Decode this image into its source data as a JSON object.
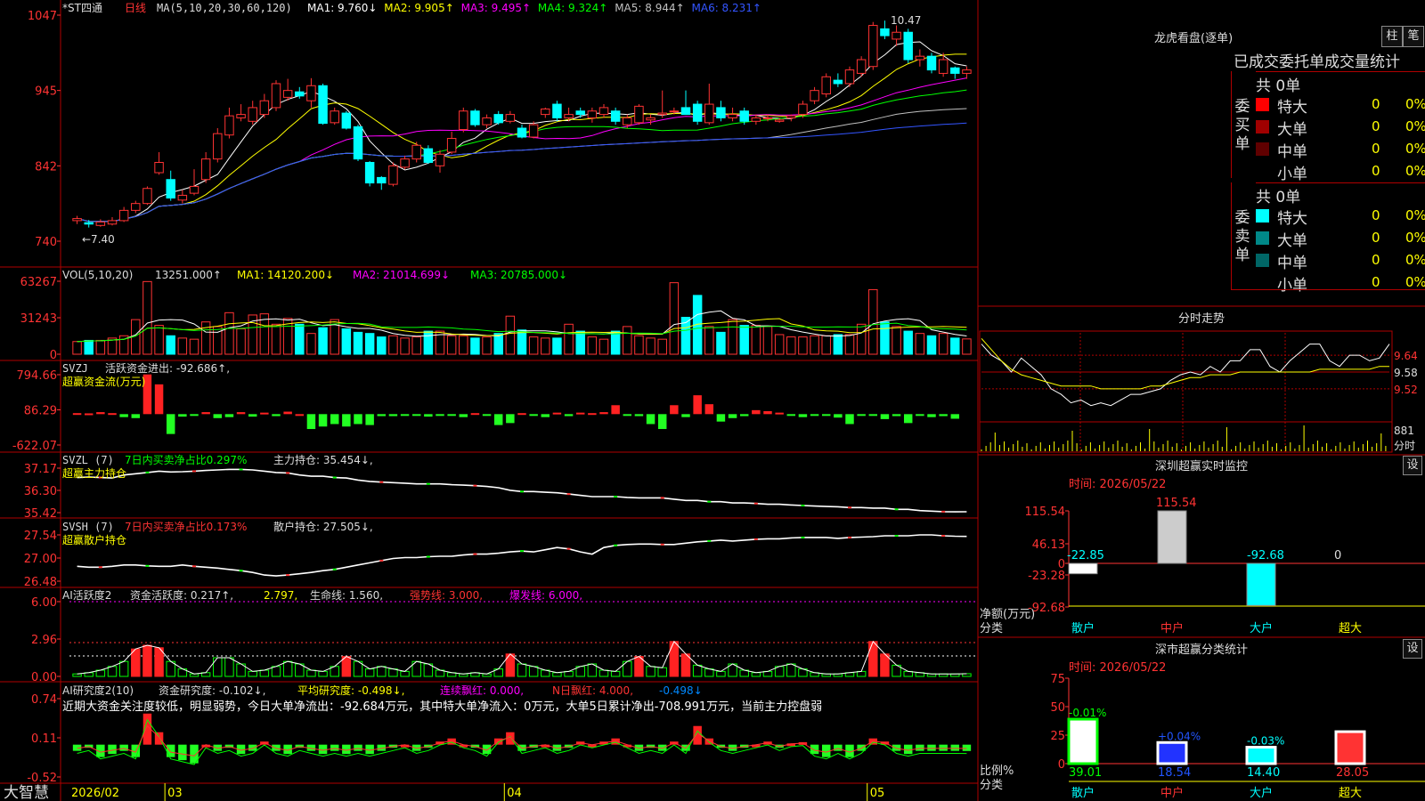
{
  "chart_data": {
    "type": "stock-candlestick",
    "stock": "*ST四通",
    "period": "日线",
    "date_label": "2026/02",
    "month_labels": [
      "03",
      "04",
      "05"
    ],
    "price_axis": [
      1047,
      945,
      842,
      740
    ],
    "ylim": [
      7.25,
      10.55
    ],
    "max_label": "10.47",
    "min_label": "←7.40",
    "ma_header": "MA(5,10,20,30,60,120)",
    "ma_values": [
      {
        "name": "MA1",
        "value": "9.760↓",
        "color": "#ffffff"
      },
      {
        "name": "MA2",
        "value": "9.905↑",
        "color": "#ffff00"
      },
      {
        "name": "MA3",
        "value": "9.495↑",
        "color": "#ff00ff"
      },
      {
        "name": "MA4",
        "value": "9.324↑",
        "color": "#00ff00"
      },
      {
        "name": "MA5",
        "value": "8.944↑",
        "color": "#c0c0c0"
      },
      {
        "name": "MA6",
        "value": "8.231↑",
        "color": "#3355ff"
      }
    ],
    "candles": [
      [
        7.55,
        7.58,
        7.5,
        7.62
      ],
      [
        7.52,
        7.5,
        7.45,
        7.56
      ],
      [
        7.48,
        7.53,
        7.46,
        7.57
      ],
      [
        7.5,
        7.55,
        7.48,
        7.6
      ],
      [
        7.55,
        7.7,
        7.53,
        7.75
      ],
      [
        7.7,
        7.8,
        7.66,
        7.84
      ],
      [
        7.8,
        8.02,
        7.78,
        8.05
      ],
      [
        8.25,
        8.4,
        8.22,
        8.55
      ],
      [
        8.15,
        7.88,
        7.84,
        8.28
      ],
      [
        7.85,
        7.92,
        7.8,
        8.0
      ],
      [
        7.95,
        8.05,
        7.92,
        8.3
      ],
      [
        8.15,
        8.45,
        8.1,
        8.55
      ],
      [
        8.45,
        8.82,
        8.4,
        8.9
      ],
      [
        8.8,
        9.08,
        8.75,
        9.2
      ],
      [
        9.05,
        9.1,
        9.0,
        9.25
      ],
      [
        9.0,
        9.2,
        8.95,
        9.3
      ],
      [
        9.1,
        9.3,
        9.05,
        9.4
      ],
      [
        9.2,
        9.55,
        9.15,
        9.6
      ],
      [
        9.35,
        9.45,
        9.3,
        9.62
      ],
      [
        9.43,
        9.37,
        9.33,
        9.5
      ],
      [
        9.3,
        9.52,
        9.2,
        9.63
      ],
      [
        9.52,
        8.97,
        8.95,
        9.55
      ],
      [
        8.98,
        9.15,
        8.95,
        9.2
      ],
      [
        9.12,
        8.9,
        8.88,
        9.15
      ],
      [
        8.92,
        8.45,
        8.42,
        8.95
      ],
      [
        8.4,
        8.1,
        8.05,
        8.42
      ],
      [
        8.18,
        8.1,
        8.0,
        8.2
      ],
      [
        8.08,
        8.35,
        8.05,
        8.4
      ],
      [
        8.33,
        8.45,
        8.3,
        8.5
      ],
      [
        8.45,
        8.65,
        8.4,
        8.7
      ],
      [
        8.6,
        8.4,
        8.38,
        8.65
      ],
      [
        8.35,
        8.52,
        8.25,
        8.58
      ],
      [
        8.55,
        8.75,
        8.52,
        8.85
      ],
      [
        8.88,
        9.15,
        8.84,
        9.2
      ],
      [
        9.15,
        8.95,
        8.92,
        9.18
      ],
      [
        8.95,
        9.05,
        8.9,
        9.1
      ],
      [
        9.1,
        8.98,
        8.95,
        9.15
      ],
      [
        9.0,
        9.1,
        8.97,
        9.15
      ],
      [
        8.9,
        8.77,
        8.75,
        8.95
      ],
      [
        8.77,
        8.95,
        8.75,
        9.0
      ],
      [
        9.1,
        9.18,
        9.05,
        9.2
      ],
      [
        9.25,
        9.05,
        9.0,
        9.3
      ],
      [
        9.05,
        9.1,
        9.0,
        9.2
      ],
      [
        9.15,
        9.1,
        9.05,
        9.2
      ],
      [
        9.05,
        9.15,
        8.98,
        9.2
      ],
      [
        9.1,
        9.2,
        9.05,
        9.25
      ],
      [
        9.15,
        9.0,
        8.95,
        9.2
      ],
      [
        8.95,
        9.05,
        8.9,
        9.1
      ],
      [
        8.98,
        9.22,
        8.95,
        9.25
      ],
      [
        9.02,
        9.05,
        8.95,
        9.1
      ],
      [
        9.1,
        9.12,
        9.05,
        9.45
      ],
      [
        9.15,
        9.15,
        9.1,
        9.2
      ],
      [
        9.2,
        9.1,
        9.1,
        9.45
      ],
      [
        9.25,
        9.0,
        8.95,
        9.3
      ],
      [
        8.98,
        9.25,
        8.95,
        9.55
      ],
      [
        9.2,
        9.05,
        9.0,
        9.3
      ],
      [
        9.05,
        9.1,
        9.0,
        9.2
      ],
      [
        9.15,
        9.0,
        8.95,
        9.2
      ],
      [
        9.0,
        9.05,
        8.95,
        9.1
      ],
      [
        9.05,
        9.05,
        9.0,
        9.1
      ],
      [
        9.0,
        9.02,
        8.98,
        9.05
      ],
      [
        9.05,
        9.08,
        9.0,
        9.1
      ],
      [
        9.1,
        9.25,
        9.05,
        9.3
      ],
      [
        9.3,
        9.45,
        9.25,
        9.5
      ],
      [
        9.4,
        9.65,
        9.35,
        9.7
      ],
      [
        9.6,
        9.55,
        9.5,
        9.7
      ],
      [
        9.55,
        9.75,
        9.5,
        9.8
      ],
      [
        9.7,
        9.9,
        9.65,
        9.95
      ],
      [
        9.8,
        10.4,
        9.75,
        10.45
      ],
      [
        10.35,
        10.25,
        10.2,
        10.47
      ],
      [
        10.2,
        10.3,
        10.1,
        10.4
      ],
      [
        10.3,
        9.9,
        9.85,
        10.35
      ],
      [
        9.9,
        9.95,
        9.8,
        10.05
      ],
      [
        9.95,
        9.75,
        9.7,
        10.0
      ],
      [
        9.7,
        9.9,
        9.65,
        10.0
      ],
      [
        9.78,
        9.7,
        9.62,
        9.8
      ],
      [
        9.7,
        9.75,
        9.62,
        9.8
      ]
    ],
    "vol_header": {
      "name": "VOL(5,10,20)",
      "value": "13251.000↑",
      "ma1": "MA1: 14120.200↓",
      "ma2": "MA2: 21014.699↓",
      "ma3": "MA3: 20785.000↓"
    },
    "vol_axis": [
      "63267",
      "31243",
      "0"
    ],
    "volumes": [
      11000,
      12000,
      12000,
      14000,
      16000,
      30000,
      63000,
      25000,
      16000,
      14000,
      13000,
      28000,
      24000,
      36000,
      22000,
      34000,
      35000,
      26000,
      31000,
      26000,
      18000,
      23000,
      30000,
      22000,
      19000,
      18000,
      15000,
      16000,
      14000,
      15000,
      20000,
      20000,
      16000,
      16000,
      14000,
      15000,
      18000,
      33000,
      21000,
      15000,
      14000,
      14000,
      26000,
      20000,
      15000,
      13000,
      20000,
      24000,
      16000,
      14000,
      13000,
      62000,
      32000,
      51000,
      24000,
      19000,
      30000,
      25000,
      25000,
      24000,
      17000,
      15000,
      15000,
      16000,
      16000,
      17000,
      17000,
      26000,
      56000,
      28000,
      24000,
      20000,
      18000,
      16000,
      18000,
      14000,
      13251
    ],
    "svzj_header": {
      "name": "SVZJ",
      "label": "活跃资金进出: -92.686↑,",
      "sub": "超赢资金流(万元)"
    },
    "svzj_axis": [
      "794.66",
      "86.29",
      "-622.07"
    ],
    "svzj": [
      20,
      15,
      40,
      20,
      -60,
      -80,
      800,
      600,
      -400,
      -50,
      -20,
      40,
      -80,
      -60,
      40,
      -50,
      30,
      -40,
      50,
      0,
      -300,
      -250,
      -200,
      -250,
      -200,
      -220,
      -40,
      -40,
      -30,
      -20,
      -50,
      -30,
      -20,
      -60,
      20,
      -30,
      -220,
      -180,
      20,
      -30,
      -60,
      30,
      -40,
      30,
      20,
      40,
      180,
      -30,
      -40,
      -200,
      -300,
      180,
      -60,
      380,
      200,
      -150,
      -80,
      -40,
      80,
      60,
      30,
      -30,
      -60,
      -30,
      -30,
      -70,
      -200,
      -30,
      -20,
      -100,
      -40,
      -180,
      -30,
      -60,
      -40,
      -92.686
    ],
    "svzl_header": {
      "name": "SVZL (7)",
      "net": "7日内买卖净占比0.297%",
      "pos": "主力持仓: 35.454↓,",
      "sub": "超赢主力持仓"
    },
    "svzl_axis": [
      "37.17",
      "36.30",
      "35.42"
    ],
    "svzl": [
      36.8,
      36.82,
      36.8,
      36.78,
      36.9,
      36.95,
      37.0,
      37.05,
      37.02,
      37.03,
      37.05,
      37.08,
      37.1,
      37.12,
      37.12,
      37.1,
      37.05,
      37.0,
      36.98,
      36.9,
      36.85,
      36.85,
      36.8,
      36.78,
      36.7,
      36.65,
      36.62,
      36.6,
      36.58,
      36.55,
      36.55,
      36.55,
      36.52,
      36.5,
      36.48,
      36.45,
      36.4,
      36.3,
      36.25,
      36.25,
      36.22,
      36.2,
      36.15,
      36.1,
      36.05,
      36.05,
      36.05,
      36.02,
      36.0,
      36.0,
      36.0,
      35.95,
      35.9,
      35.9,
      35.85,
      35.85,
      35.8,
      35.8,
      35.78,
      35.75,
      35.75,
      35.72,
      35.7,
      35.68,
      35.66,
      35.65,
      35.62,
      35.62,
      35.6,
      35.6,
      35.55,
      35.55,
      35.5,
      35.48,
      35.46,
      35.45,
      35.454
    ],
    "svsh_header": {
      "name": "SVSH (7)",
      "net": "7日内买卖净占比0.173%",
      "pos": "散户持仓: 27.505↓,",
      "sub": "超赢散户持仓"
    },
    "svsh_axis": [
      "27.54",
      "27.00",
      "26.48"
    ],
    "svsh": [
      26.82,
      26.8,
      26.8,
      26.82,
      26.85,
      26.85,
      26.83,
      26.82,
      26.82,
      26.85,
      26.82,
      26.8,
      26.78,
      26.75,
      26.72,
      26.68,
      26.62,
      26.6,
      26.62,
      26.65,
      26.68,
      26.72,
      26.75,
      26.8,
      26.85,
      26.9,
      26.95,
      27.0,
      27.02,
      27.02,
      27.04,
      27.05,
      27.05,
      27.08,
      27.1,
      27.1,
      27.12,
      27.15,
      27.17,
      27.15,
      27.2,
      27.25,
      27.22,
      27.15,
      27.1,
      27.25,
      27.3,
      27.32,
      27.33,
      27.33,
      27.32,
      27.32,
      27.35,
      27.38,
      27.4,
      27.42,
      27.4,
      27.42,
      27.44,
      27.45,
      27.45,
      27.47,
      27.48,
      27.48,
      27.48,
      27.46,
      27.48,
      27.49,
      27.5,
      27.52,
      27.52,
      27.52,
      27.54,
      27.54,
      27.52,
      27.51,
      27.505
    ],
    "ai_header": {
      "name": "AI活跃度2",
      "a": "资金活跃度: 0.217↑,",
      "b": "2.797,",
      "c": "生命线: 1.560,",
      "d": "强势线: 3.000,",
      "e": "爆发线: 6.000,"
    },
    "ai_axis": [
      "6.00",
      "2.96",
      "0.00"
    ],
    "ai": [
      0.2,
      0.3,
      0.5,
      0.8,
      1.2,
      2.2,
      2.5,
      2.3,
      1.2,
      0.6,
      0.2,
      0.3,
      1.5,
      1.5,
      1.0,
      0.4,
      0.5,
      0.8,
      1.2,
      1.0,
      0.5,
      0.4,
      0.8,
      1.6,
      1.2,
      0.6,
      0.8,
      0.6,
      0.4,
      1.2,
      1.0,
      0.5,
      0.3,
      0.2,
      0.3,
      0.2,
      0.6,
      1.8,
      1.0,
      0.8,
      0.5,
      0.3,
      0.4,
      0.8,
      1.0,
      0.5,
      0.4,
      1.2,
      1.6,
      0.8,
      0.7,
      2.8,
      1.8,
      0.9,
      0.6,
      0.4,
      1.0,
      0.5,
      0.3,
      0.4,
      0.8,
      1.0,
      0.6,
      0.3,
      0.2,
      0.2,
      0.3,
      0.4,
      2.8,
      1.8,
      0.9,
      0.4,
      0.3,
      0.2,
      0.2,
      0.2,
      0.217
    ],
    "ai2_header": {
      "name": "AI研究度2(10)",
      "a": "资金研究度: -0.102↓,",
      "b": "平均研究度: -0.498↓,",
      "c": "连续飘红: 0.000,",
      "d": "N日飘红: 4.000,",
      "e": "-0.498↓"
    },
    "ai2_axis": [
      "0.74",
      "0.11",
      "-0.52"
    ],
    "ai2_text": "近期大资金关注度较低，明显弱势，今日大单净流出：-92.684万元，其中特大单净流入：0万元，大单5日累计净出-708.991万元，当前主力控盘弱",
    "ai2": [
      -0.1,
      -0.05,
      -0.2,
      -0.15,
      -0.1,
      -0.2,
      0.5,
      0.2,
      -0.2,
      -0.25,
      -0.3,
      0.0,
      -0.1,
      -0.05,
      -0.15,
      -0.1,
      0.05,
      -0.1,
      -0.15,
      -0.05,
      -0.1,
      -0.15,
      -0.1,
      -0.15,
      -0.1,
      -0.15,
      -0.1,
      -0.05,
      0.0,
      -0.1,
      -0.05,
      0.05,
      0.1,
      0.0,
      -0.05,
      -0.15,
      0.1,
      0.2,
      -0.1,
      -0.05,
      0.0,
      -0.1,
      -0.05,
      0.05,
      0.0,
      0.05,
      0.1,
      0.0,
      -0.1,
      -0.05,
      -0.1,
      0.05,
      -0.1,
      0.3,
      0.1,
      -0.05,
      -0.1,
      -0.05,
      0.0,
      0.05,
      -0.05,
      0.02,
      0.04,
      -0.15,
      -0.2,
      -0.1,
      -0.2,
      -0.1,
      0.1,
      0.05,
      -0.1,
      -0.15,
      -0.1,
      -0.1,
      -0.1,
      -0.1,
      -0.102
    ]
  },
  "brand": "大智慧",
  "longhu": {
    "title": "龙虎看盘(逐单)",
    "tab1": "柱",
    "tab2": "笔",
    "subtitle": "已成交委托单成交量统计",
    "buy": {
      "group": "委买单",
      "total": "共 0单",
      "rows": [
        {
          "label": "特大",
          "v": "0",
          "p": "0%",
          "color": "#ff0000"
        },
        {
          "label": "大单",
          "v": "0",
          "p": "0%",
          "color": "#a00000"
        },
        {
          "label": "中单",
          "v": "0",
          "p": "0%",
          "color": "#600000"
        },
        {
          "label": "小单",
          "v": "0",
          "p": "0%",
          "color": "#000000"
        }
      ]
    },
    "sell": {
      "group": "委卖单",
      "total": "共 0单",
      "rows": [
        {
          "label": "特大",
          "v": "0",
          "p": "0%",
          "color": "#00ffff"
        },
        {
          "label": "大单",
          "v": "0",
          "p": "0%",
          "color": "#008888"
        },
        {
          "label": "中单",
          "v": "0",
          "p": "0%",
          "color": "#006666"
        },
        {
          "label": "小单",
          "v": "0",
          "p": "0%",
          "color": "#000000"
        }
      ]
    }
  },
  "fenshi": {
    "title": "分时走势",
    "axis": [
      "9.64",
      "9.58",
      "9.52"
    ],
    "vol_label": "881",
    "vol_unit": "分时",
    "price": [
      9.68,
      9.64,
      9.62,
      9.58,
      9.63,
      9.6,
      9.57,
      9.52,
      9.5,
      9.47,
      9.48,
      9.46,
      9.47,
      9.46,
      9.48,
      9.5,
      9.5,
      9.51,
      9.52,
      9.55,
      9.57,
      9.58,
      9.57,
      9.6,
      9.58,
      9.62,
      9.62,
      9.66,
      9.66,
      9.6,
      9.58,
      9.62,
      9.65,
      9.68,
      9.68,
      9.62,
      9.6,
      9.64,
      9.64,
      9.62,
      9.63,
      9.68
    ],
    "avg": [
      9.7,
      9.66,
      9.62,
      9.59,
      9.57,
      9.56,
      9.55,
      9.54,
      9.53,
      9.53,
      9.53,
      9.53,
      9.52,
      9.52,
      9.52,
      9.52,
      9.52,
      9.53,
      9.53,
      9.54,
      9.55,
      9.56,
      9.56,
      9.57,
      9.57,
      9.57,
      9.58,
      9.58,
      9.58,
      9.58,
      9.58,
      9.58,
      9.58,
      9.58,
      9.59,
      9.59,
      9.59,
      9.59,
      9.59,
      9.59,
      9.6,
      9.6
    ]
  },
  "sz_monitor": {
    "title": "深圳超赢实时监控",
    "button": "设",
    "time": "时间: 2026/05/22",
    "axis": [
      "115.54",
      "46.13",
      "0",
      "-23.28",
      "-92.68"
    ],
    "unit_label": "净额(万元)",
    "cat_label": "分类",
    "bars": [
      {
        "name": "散户",
        "value": -22.85,
        "label": "-22.85"
      },
      {
        "name": "中户",
        "value": 115.54,
        "label": "115.54"
      },
      {
        "name": "大户",
        "value": -92.68,
        "label": "-92.68"
      },
      {
        "name": "超大",
        "value": 0,
        "label": "0"
      }
    ]
  },
  "sm_stats": {
    "title": "深市超赢分类统计",
    "button": "设",
    "time": "时间: 2026/05/22",
    "axis": [
      "75",
      "50",
      "25",
      "0"
    ],
    "unit_label": "比例%",
    "cat_label": "分类",
    "bars": [
      {
        "name": "散户",
        "value": 39.01,
        "label": "39.01",
        "delta": "-0.01%"
      },
      {
        "name": "中户",
        "value": 18.54,
        "label": "18.54",
        "delta": "+0.04%"
      },
      {
        "name": "大户",
        "value": 14.4,
        "label": "14.40",
        "delta": "-0.03%"
      },
      {
        "name": "超大",
        "value": 28.05,
        "label": "28.05",
        "delta": ""
      }
    ]
  }
}
